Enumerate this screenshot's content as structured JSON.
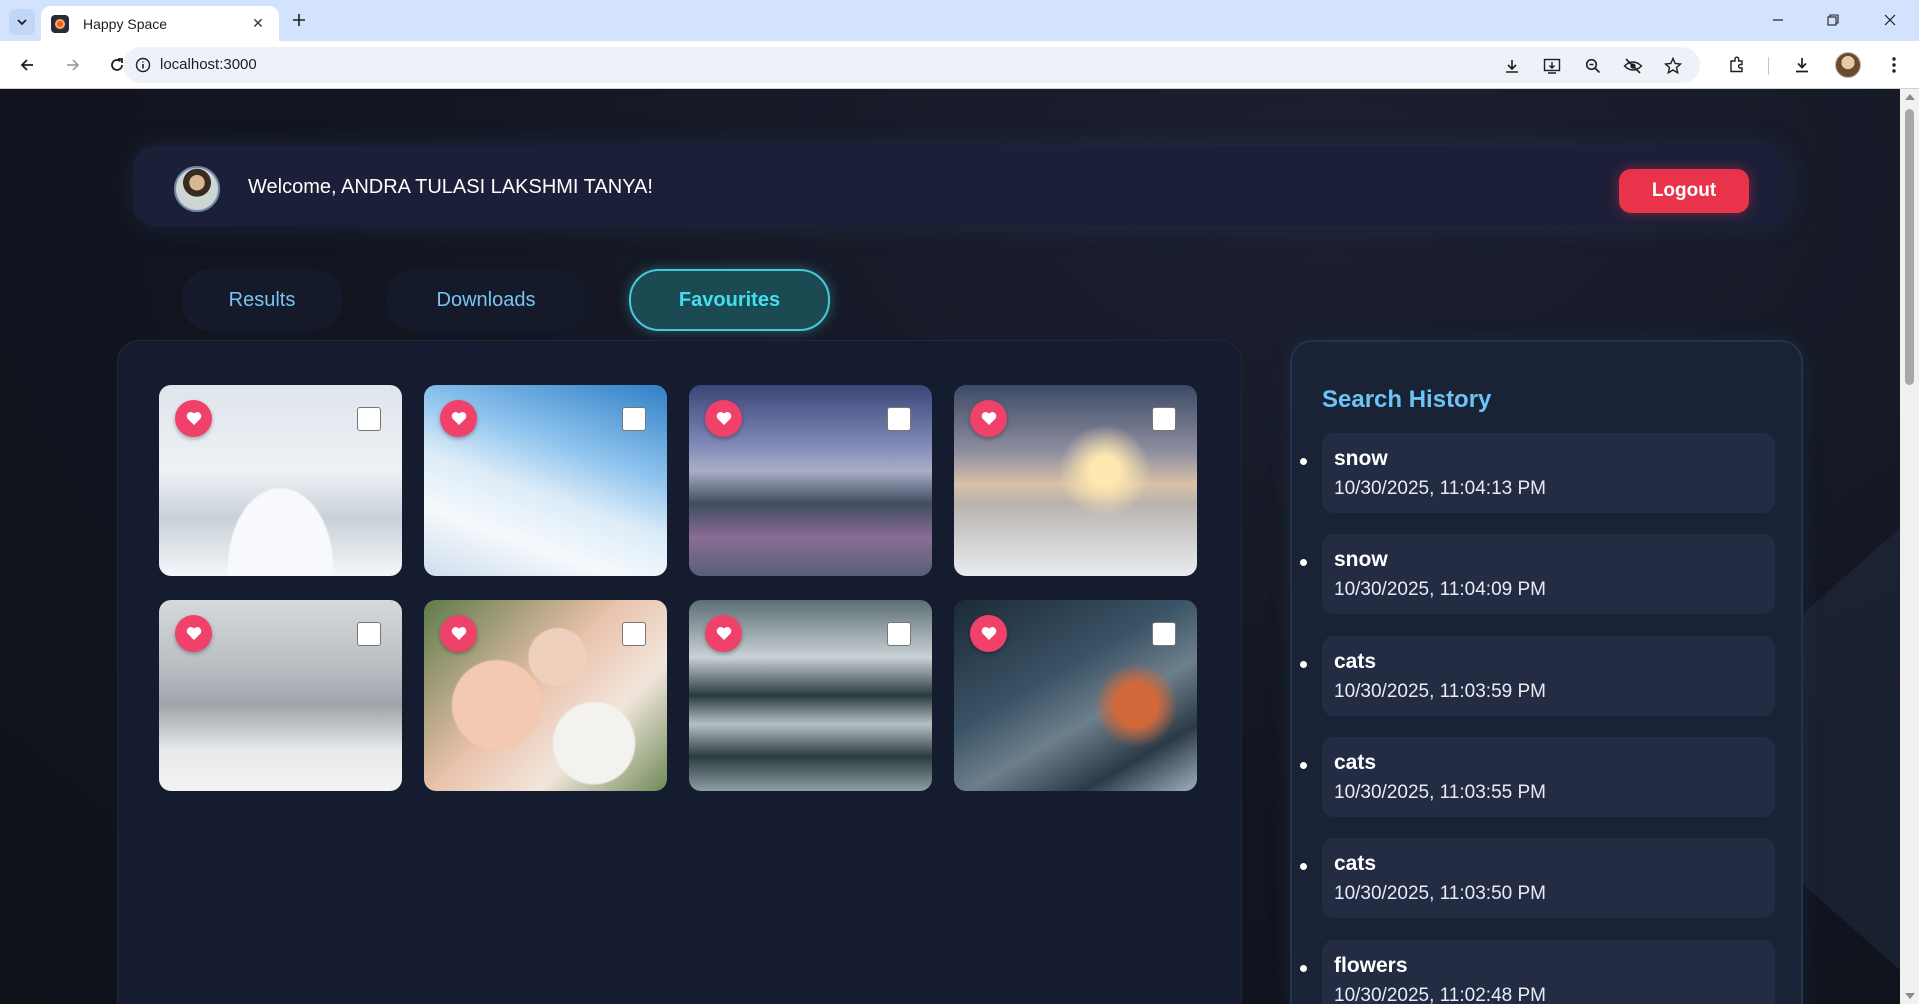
{
  "browser": {
    "tab_title": "Happy Space",
    "url": "localhost:3000"
  },
  "header": {
    "welcome": "Welcome, ANDRA TULASI LAKSHMI TANYA!",
    "logout_label": "Logout"
  },
  "nav": {
    "tabs": [
      {
        "label": "Results"
      },
      {
        "label": "Downloads"
      },
      {
        "label": "Favourites"
      }
    ],
    "active": "Favourites"
  },
  "gallery": {
    "images": [
      {
        "subject": "snowy street with lamps",
        "favourite": true,
        "selected": false
      },
      {
        "subject": "snowy mountain slope",
        "favourite": true,
        "selected": false
      },
      {
        "subject": "winter mountain valley",
        "favourite": true,
        "selected": false
      },
      {
        "subject": "snow field at sunset",
        "favourite": true,
        "selected": false
      },
      {
        "subject": "church in snowy mountains",
        "favourite": true,
        "selected": false
      },
      {
        "subject": "peach and white flower bouquet",
        "favourite": true,
        "selected": false
      },
      {
        "subject": "mountain lake reflection",
        "favourite": true,
        "selected": false
      },
      {
        "subject": "snowy street at night",
        "favourite": true,
        "selected": false
      }
    ]
  },
  "history": {
    "title": "Search History",
    "items": [
      {
        "query": "snow",
        "time": "10/30/2025, 11:04:13 PM"
      },
      {
        "query": "snow",
        "time": "10/30/2025, 11:04:09 PM"
      },
      {
        "query": "cats",
        "time": "10/30/2025, 11:03:59 PM"
      },
      {
        "query": "cats",
        "time": "10/30/2025, 11:03:55 PM"
      },
      {
        "query": "cats",
        "time": "10/30/2025, 11:03:50 PM"
      },
      {
        "query": "flowers",
        "time": "10/30/2025, 11:02:48 PM"
      }
    ]
  },
  "colors": {
    "accent": "#3fe0f2",
    "logout": "#e8334a",
    "heart": "#f0416a",
    "history_title": "#6cc4f4"
  }
}
